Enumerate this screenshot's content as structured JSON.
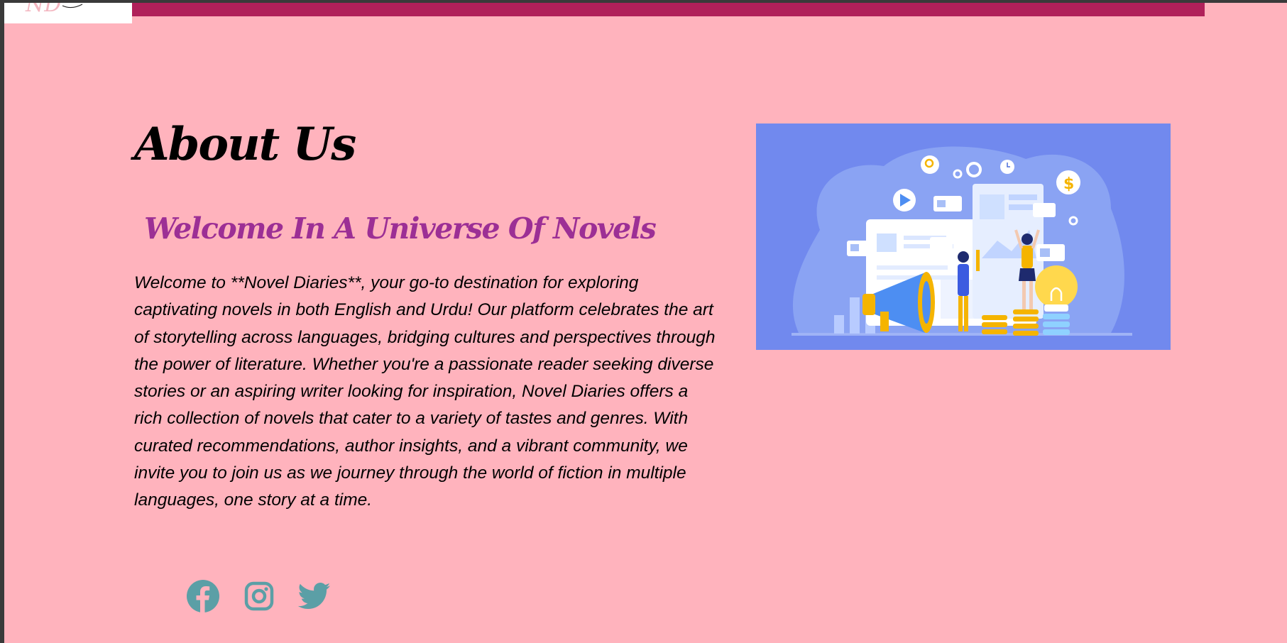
{
  "header": {
    "logo_alt": "ND",
    "bar_color": "#b0205a"
  },
  "about": {
    "title": "About Us",
    "subtitle": "Welcome In A Universe Of Novels",
    "description": "Welcome to **Novel Diaries**, your go-to destination for exploring captivating novels in both English and Urdu! Our platform celebrates the art of storytelling across languages, bridging cultures and perspectives through the power of literature. Whether you're a passionate reader seeking diverse stories or an aspiring writer looking for inspiration, Novel Diaries offers a rich collection of novels that cater to a variety of tastes and genres. With curated recommendations, author insights, and a vibrant community, we invite you to join us as we journey through the world of fiction in multiple languages, one story at a time."
  },
  "hero_image": {
    "icon": "digital-marketing-illustration"
  },
  "social": [
    {
      "name": "facebook",
      "icon": "facebook-icon"
    },
    {
      "name": "instagram",
      "icon": "instagram-icon"
    },
    {
      "name": "twitter",
      "icon": "twitter-icon"
    }
  ],
  "colors": {
    "background": "#ffb3bd",
    "title": "#000000",
    "subtitle": "#9c2f95",
    "social_icon": "#5b9fa6",
    "hero_bg": "#7189ee"
  }
}
